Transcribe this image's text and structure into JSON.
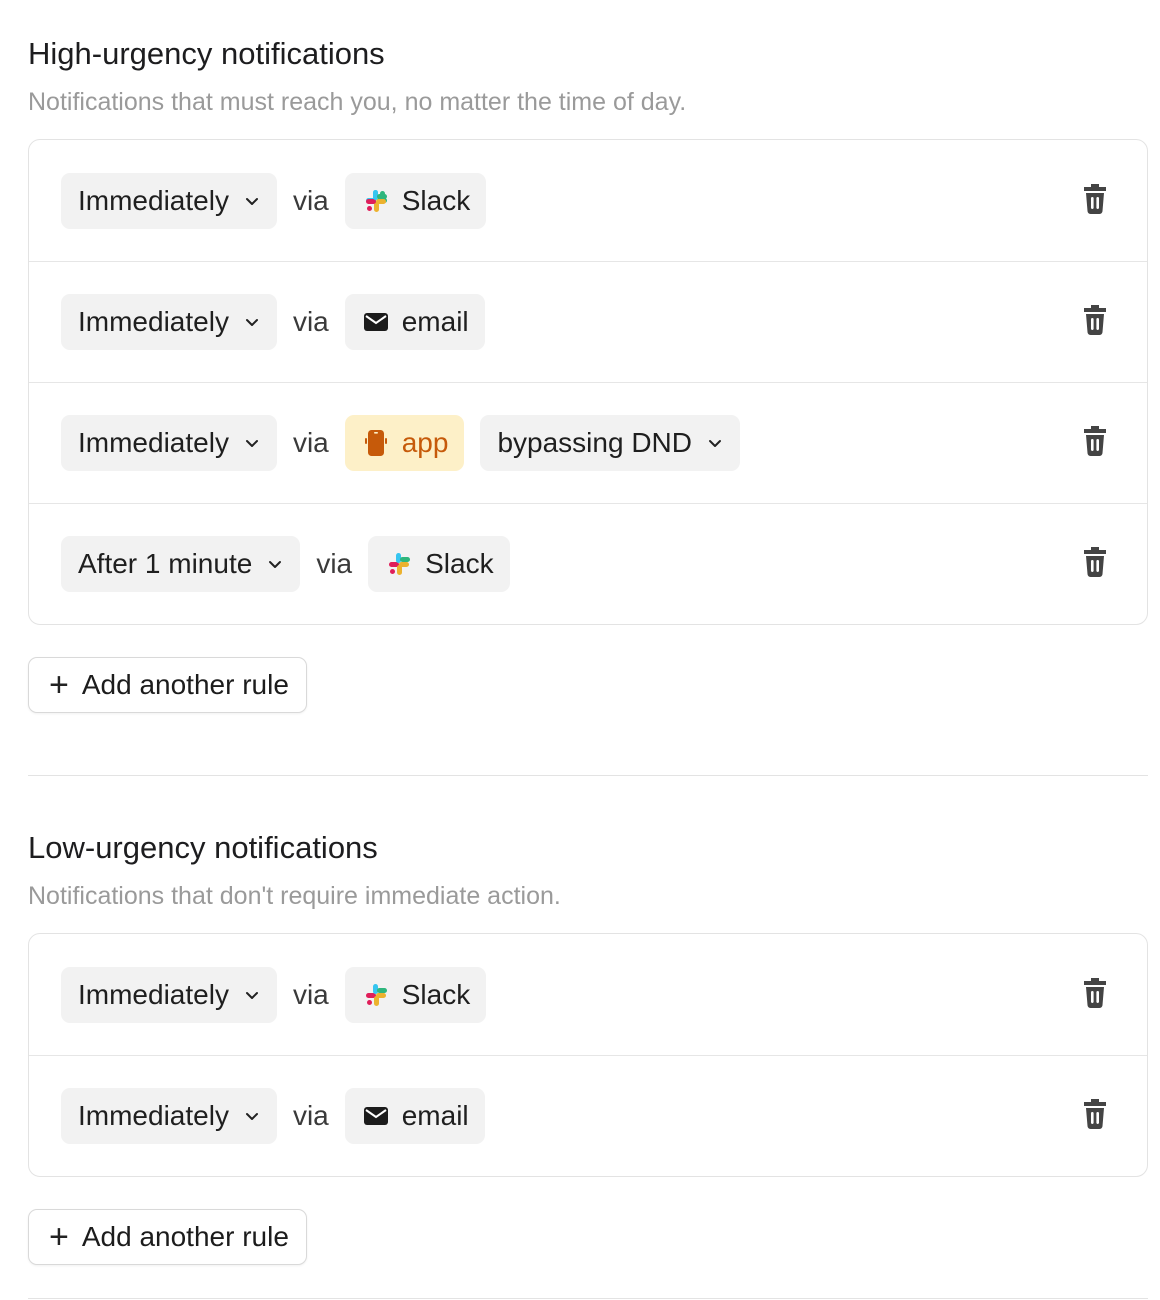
{
  "high": {
    "title": "High-urgency notifications",
    "subtitle": "Notifications that must reach you, no matter the time of day.",
    "rules": [
      {
        "timing": "Immediately",
        "via": "via",
        "channel": "Slack",
        "channel_icon": "slack-icon"
      },
      {
        "timing": "Immediately",
        "via": "via",
        "channel": "email",
        "channel_icon": "envelope-icon"
      },
      {
        "timing": "Immediately",
        "via": "via",
        "channel": "app",
        "channel_icon": "phone-icon",
        "option": "bypassing DND"
      },
      {
        "timing": "After 1 minute",
        "via": "via",
        "channel": "Slack",
        "channel_icon": "slack-icon"
      }
    ],
    "add_label": "Add another rule"
  },
  "low": {
    "title": "Low-urgency notifications",
    "subtitle": "Notifications that don't require immediate action.",
    "rules": [
      {
        "timing": "Immediately",
        "via": "via",
        "channel": "Slack",
        "channel_icon": "slack-icon"
      },
      {
        "timing": "Immediately",
        "via": "via",
        "channel": "email",
        "channel_icon": "envelope-icon"
      }
    ],
    "add_label": "Add another rule"
  },
  "colors": {
    "app_pill_bg": "#fdf0c8",
    "app_pill_text": "#c65a0a",
    "pill_bg": "#f2f2f2",
    "slack_blue": "#36c5f0",
    "slack_green": "#2eb67d",
    "slack_yellow": "#ecb22e",
    "slack_red": "#e01e5a"
  }
}
